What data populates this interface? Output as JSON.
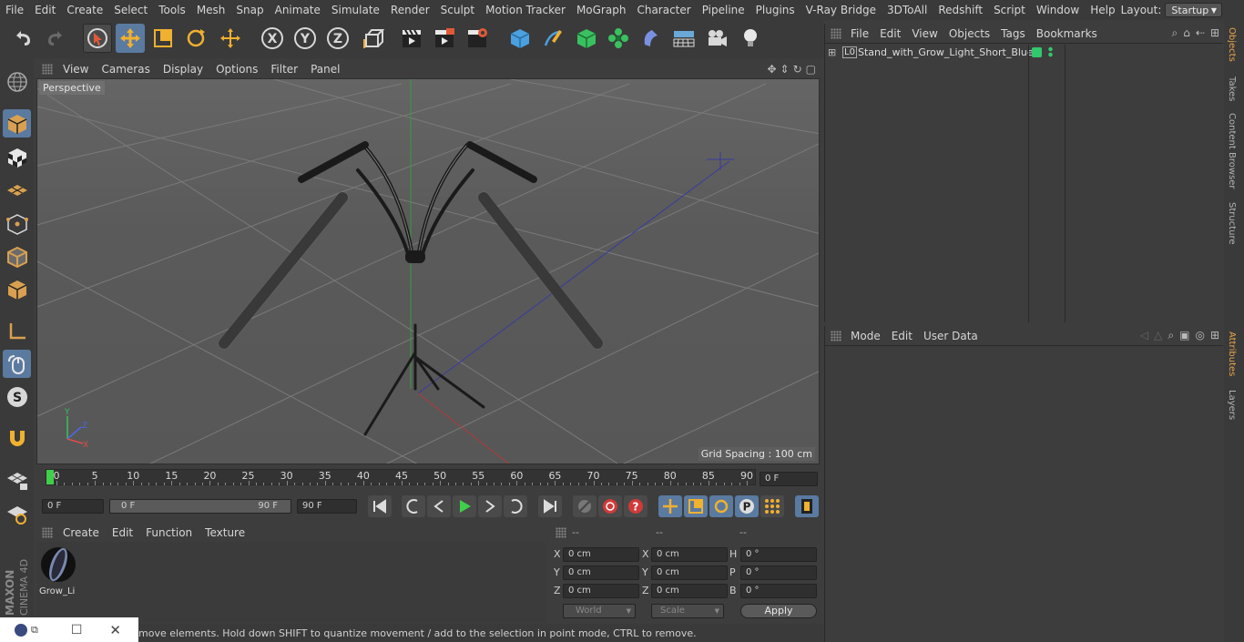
{
  "menubar": {
    "items": [
      "File",
      "Edit",
      "Create",
      "Select",
      "Tools",
      "Mesh",
      "Snap",
      "Animate",
      "Simulate",
      "Render",
      "Sculpt",
      "Motion Tracker",
      "MoGraph",
      "Character",
      "Pipeline",
      "Plugins",
      "V-Ray Bridge",
      "3DToAll",
      "Redshift",
      "Script",
      "Window",
      "Help"
    ],
    "layout_label": "Layout:",
    "layout_value": "Startup"
  },
  "viewport": {
    "menu": [
      "View",
      "Cameras",
      "Display",
      "Options",
      "Filter",
      "Panel"
    ],
    "label": "Perspective",
    "grid_spacing": "Grid Spacing : 100 cm",
    "axis_labels": {
      "y": "Y",
      "z": "Z",
      "x": "X"
    }
  },
  "timeline": {
    "ticks": [
      "0",
      "5",
      "10",
      "15",
      "20",
      "25",
      "30",
      "35",
      "40",
      "45",
      "50",
      "55",
      "60",
      "65",
      "70",
      "75",
      "80",
      "85",
      "90"
    ],
    "current_frame": "0 F",
    "start_frame": "0 F",
    "range_start": "0 F",
    "range_end": "90 F",
    "end_frame": "90 F"
  },
  "material": {
    "menu": [
      "Create",
      "Edit",
      "Function",
      "Texture"
    ],
    "item_name": "Grow_Li"
  },
  "coordinates": {
    "headers": [
      "--",
      "--",
      "--"
    ],
    "rows": [
      {
        "a": "X",
        "av": "0 cm",
        "b": "X",
        "bv": "0 cm",
        "c": "H",
        "cv": "0 °"
      },
      {
        "a": "Y",
        "av": "0 cm",
        "b": "Y",
        "bv": "0 cm",
        "c": "P",
        "cv": "0 °"
      },
      {
        "a": "Z",
        "av": "0 cm",
        "b": "Z",
        "bv": "0 cm",
        "c": "B",
        "cv": "0 °"
      }
    ],
    "world": "World",
    "scale": "Scale",
    "apply": "Apply"
  },
  "status": {
    "text": "move elements. Hold down SHIFT to quantize movement / add to the selection in point mode, CTRL to remove."
  },
  "objects": {
    "menu": [
      "File",
      "Edit",
      "View",
      "Objects",
      "Tags",
      "Bookmarks"
    ],
    "item_name": "Stand_with_Grow_Light_Short_Blue",
    "layer_marker": "L0"
  },
  "attributes": {
    "menu": [
      "Mode",
      "Edit",
      "User Data"
    ]
  },
  "right_tabs": [
    "Objects",
    "Takes",
    "Content Browser",
    "Structure",
    "Attributes",
    "Layers"
  ],
  "branding": {
    "maxon": "MAXON",
    "cinema": "CINEMA 4D"
  },
  "colors": {
    "accent": "#5a7aa0",
    "play_green": "#3fcf4a",
    "tab_active": "#e8a44a",
    "tag_green": "#32c86e"
  }
}
